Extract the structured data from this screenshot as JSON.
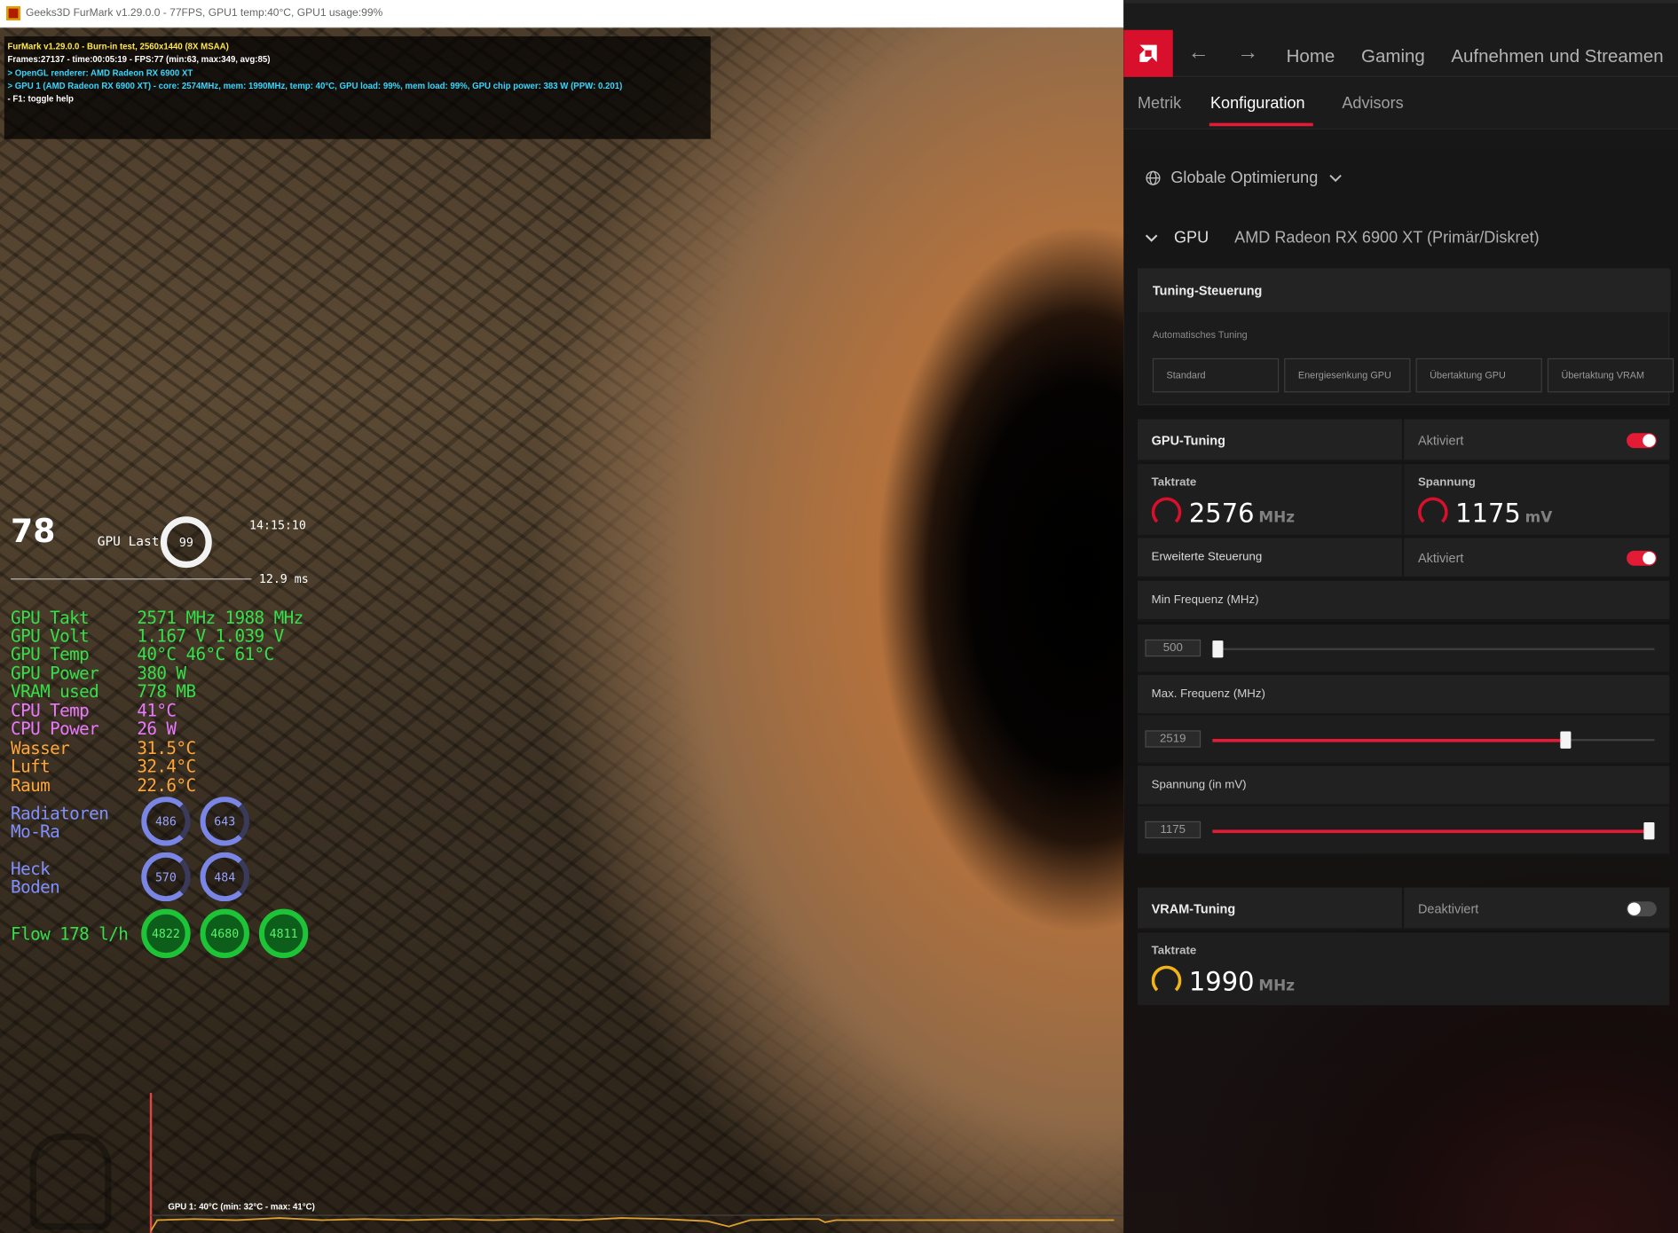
{
  "furmark": {
    "window_title": "Geeks3D FurMark v1.29.0.0 - 77FPS, GPU1 temp:40°C, GPU1 usage:99%",
    "info_lines": [
      "FurMark v1.29.0.0 - Burn-in test, 2560x1440 (8X MSAA)",
      "Frames:27137 - time:00:05:19 - FPS:77 (min:63, max:349, avg:85)",
      "> OpenGL renderer: AMD Radeon RX 6900 XT",
      "> GPU 1 (AMD Radeon RX 6900 XT) - core: 2574MHz, mem: 1990MHz, temp: 40°C, GPU load: 99%, mem load: 99%, GPU chip power: 383 W (PPW: 0.201)",
      "- F1: toggle help"
    ],
    "graph_label": "GPU 1: 40°C (min: 32°C - max: 41°C)"
  },
  "overlay": {
    "fps": "78",
    "gpu_load_label": "GPU Last",
    "gpu_load_value": "99",
    "clock": "14:15:10",
    "frametime": "12.9 ms",
    "stats": [
      {
        "label": "GPU Takt",
        "value": "2571 MHz 1988 MHz",
        "color": "#34e04a"
      },
      {
        "label": "GPU Volt",
        "value": "1.167 V   1.039 V",
        "color": "#34e04a"
      },
      {
        "label": "GPU Temp",
        "value": "40°C  46°C  61°C",
        "color": "#34e04a"
      },
      {
        "label": "GPU Power",
        "value": "380 W",
        "color": "#34e04a"
      },
      {
        "label": "VRAM used",
        "value": "778 MB",
        "color": "#34e04a"
      },
      {
        "label": "CPU Temp",
        "value": "41°C",
        "color": "#ea79ff"
      },
      {
        "label": "CPU Power",
        "value": "26 W",
        "color": "#ea79ff"
      },
      {
        "label": "Wasser",
        "value": "31.5°C",
        "color": "#ffa63a"
      },
      {
        "label": "Luft",
        "value": "32.4°C",
        "color": "#ffa63a"
      },
      {
        "label": "Raum",
        "value": "22.6°C",
        "color": "#ffa63a"
      }
    ],
    "radiators_label_1": "Radiatoren",
    "radiators_label_2": "Mo-Ra",
    "radiators": [
      "486",
      "643"
    ],
    "heck_label_1": "Heck",
    "heck_label_2": "Boden",
    "heck": [
      "570",
      "484"
    ],
    "flow_label": "Flow 178 l/h",
    "flow": [
      "4822",
      "4680",
      "4811"
    ]
  },
  "amd": {
    "nav": {
      "home": "Home",
      "gaming": "Gaming",
      "record": "Aufnehmen und Streamen"
    },
    "tabs": {
      "metrics": "Metrik",
      "config": "Konfiguration",
      "advisors": "Advisors"
    },
    "scope": "Globale Optimierung",
    "gpu_label": "GPU",
    "gpu_name": "AMD Radeon RX 6900 XT (Primär/Diskret)",
    "tuning_control": "Tuning-Steuerung",
    "auto_tuning": "Automatisches Tuning",
    "presets": [
      "Standard",
      "Energiesenkung GPU",
      "Übertaktung GPU",
      "Übertaktung VRAM"
    ],
    "gpu_tuning": {
      "title": "GPU-Tuning",
      "state": "Aktiviert",
      "enabled": true
    },
    "clock_label": "Taktrate",
    "clock_value": "2576",
    "clock_unit": "MHz",
    "voltage_label": "Spannung",
    "voltage_value": "1175",
    "voltage_unit": "mV",
    "advanced": {
      "title": "Erweiterte Steuerung",
      "state": "Aktiviert",
      "enabled": true
    },
    "min_freq": {
      "label": "Min Frequenz (MHz)",
      "value": "500",
      "fraction": 0.0
    },
    "max_freq": {
      "label": "Max. Frequenz (MHz)",
      "value": "2519",
      "fraction": 0.8
    },
    "voltage_slider": {
      "label": "Spannung (in mV)",
      "value": "1175",
      "fraction": 1.0
    },
    "vram_tuning": {
      "title": "VRAM-Tuning",
      "state": "Deaktiviert",
      "enabled": false
    },
    "vram_clock_label": "Taktrate",
    "vram_clock_value": "1990",
    "vram_clock_unit": "MHz",
    "accent": "#e31b35"
  }
}
